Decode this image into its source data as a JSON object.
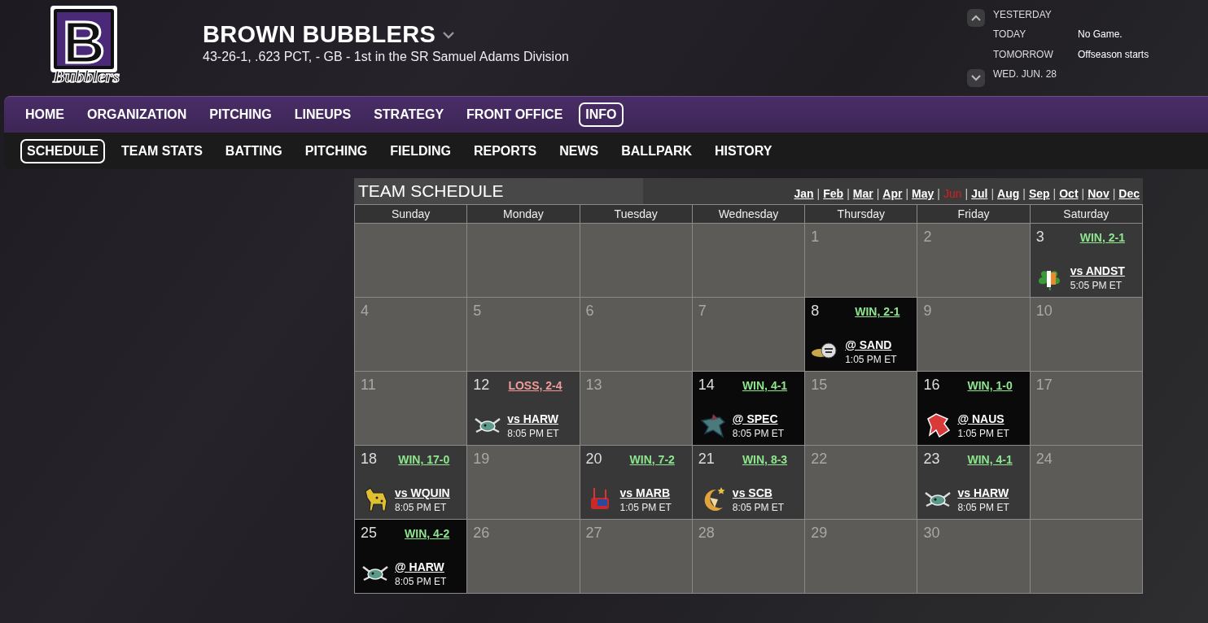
{
  "team": {
    "logo": {
      "letter": "B",
      "script": "Bubblers"
    },
    "name": "BROWN BUBBLERS",
    "record": "43-26-1, .623 PCT, - GB - 1st in the SR Samuel Adams Division"
  },
  "upcoming": [
    {
      "label": "YESTERDAY"
    },
    {
      "label": "TODAY",
      "value": "No Game."
    },
    {
      "label": "TOMORROW",
      "value": "Offseason starts"
    },
    {
      "label": "WED. JUN. 28"
    }
  ],
  "main_nav": [
    {
      "label": "HOME",
      "selected": false
    },
    {
      "label": "ORGANIZATION",
      "selected": false
    },
    {
      "label": "PITCHING",
      "selected": false
    },
    {
      "label": "LINEUPS",
      "selected": false
    },
    {
      "label": "STRATEGY",
      "selected": false
    },
    {
      "label": "FRONT OFFICE",
      "selected": false
    },
    {
      "label": "INFO",
      "selected": true
    }
  ],
  "sub_nav": [
    {
      "label": "SCHEDULE",
      "selected": true
    },
    {
      "label": "TEAM STATS",
      "selected": false
    },
    {
      "label": "BATTING",
      "selected": false
    },
    {
      "label": "PITCHING",
      "selected": false
    },
    {
      "label": "FIELDING",
      "selected": false
    },
    {
      "label": "REPORTS",
      "selected": false
    },
    {
      "label": "NEWS",
      "selected": false
    },
    {
      "label": "BALLPARK",
      "selected": false
    },
    {
      "label": "HISTORY",
      "selected": false
    }
  ],
  "schedule": {
    "title": "TEAM SCHEDULE",
    "month_separator": "|",
    "months": [
      {
        "label": "Jan",
        "selected": false
      },
      {
        "label": "Feb",
        "selected": false
      },
      {
        "label": "Mar",
        "selected": false
      },
      {
        "label": "Apr",
        "selected": false
      },
      {
        "label": "May",
        "selected": false
      },
      {
        "label": "Jun",
        "selected": true
      },
      {
        "label": "Jul",
        "selected": false
      },
      {
        "label": "Aug",
        "selected": false
      },
      {
        "label": "Sep",
        "selected": false
      },
      {
        "label": "Oct",
        "selected": false
      },
      {
        "label": "Nov",
        "selected": false
      },
      {
        "label": "Dec",
        "selected": false
      }
    ],
    "weekdays": [
      "Sunday",
      "Monday",
      "Tuesday",
      "Wednesday",
      "Thursday",
      "Friday",
      "Saturday"
    ],
    "weeks": [
      [
        {
          "kind": "day"
        },
        {
          "kind": "day"
        },
        {
          "kind": "day"
        },
        {
          "kind": "day"
        },
        {
          "kind": "day",
          "day": "1"
        },
        {
          "kind": "day",
          "day": "2"
        },
        {
          "kind": "home",
          "day": "3",
          "result": "WIN, 2-1",
          "won": true,
          "opponent": "vs ANDST",
          "time": "5:05 PM ET"
        }
      ],
      [
        {
          "kind": "day",
          "day": "4"
        },
        {
          "kind": "day",
          "day": "5"
        },
        {
          "kind": "day",
          "day": "6"
        },
        {
          "kind": "day",
          "day": "7"
        },
        {
          "kind": "away",
          "day": "8",
          "result": "WIN, 2-1",
          "won": true,
          "opponent": "@ SAND",
          "time": "1:05 PM ET"
        },
        {
          "kind": "day",
          "day": "9"
        },
        {
          "kind": "day",
          "day": "10"
        }
      ],
      [
        {
          "kind": "day",
          "day": "11"
        },
        {
          "kind": "home",
          "day": "12",
          "result": "LOSS, 2-4",
          "won": false,
          "opponent": "vs HARW",
          "time": "8:05 PM ET"
        },
        {
          "kind": "day",
          "day": "13"
        },
        {
          "kind": "away",
          "day": "14",
          "result": "WIN, 4-1",
          "won": true,
          "opponent": "@ SPEC",
          "time": "8:05 PM ET"
        },
        {
          "kind": "day",
          "day": "15"
        },
        {
          "kind": "away",
          "day": "16",
          "result": "WIN, 1-0",
          "won": true,
          "opponent": "@ NAUS",
          "time": "1:05 PM ET"
        },
        {
          "kind": "day",
          "day": "17"
        }
      ],
      [
        {
          "kind": "home",
          "day": "18",
          "result": "WIN, 17-0",
          "won": true,
          "opponent": "vs WQUIN",
          "time": "8:05 PM ET"
        },
        {
          "kind": "day",
          "day": "19"
        },
        {
          "kind": "home",
          "day": "20",
          "result": "WIN, 7-2",
          "won": true,
          "opponent": "vs MARB",
          "time": "1:05 PM ET"
        },
        {
          "kind": "home",
          "day": "21",
          "result": "WIN, 8-3",
          "won": true,
          "opponent": "vs SCB",
          "time": "8:05 PM ET"
        },
        {
          "kind": "day",
          "day": "22"
        },
        {
          "kind": "home",
          "day": "23",
          "result": "WIN, 4-1",
          "won": true,
          "opponent": "vs HARW",
          "time": "8:05 PM ET"
        },
        {
          "kind": "day",
          "day": "24"
        }
      ],
      [
        {
          "kind": "away",
          "day": "25",
          "result": "WIN, 4-2",
          "won": true,
          "opponent": "@ HARW",
          "time": "8:05 PM ET"
        },
        {
          "kind": "day",
          "day": "26"
        },
        {
          "kind": "day",
          "day": "27"
        },
        {
          "kind": "day",
          "day": "28"
        },
        {
          "kind": "day",
          "day": "29"
        },
        {
          "kind": "day",
          "day": "30"
        },
        {
          "kind": "day"
        }
      ]
    ]
  }
}
